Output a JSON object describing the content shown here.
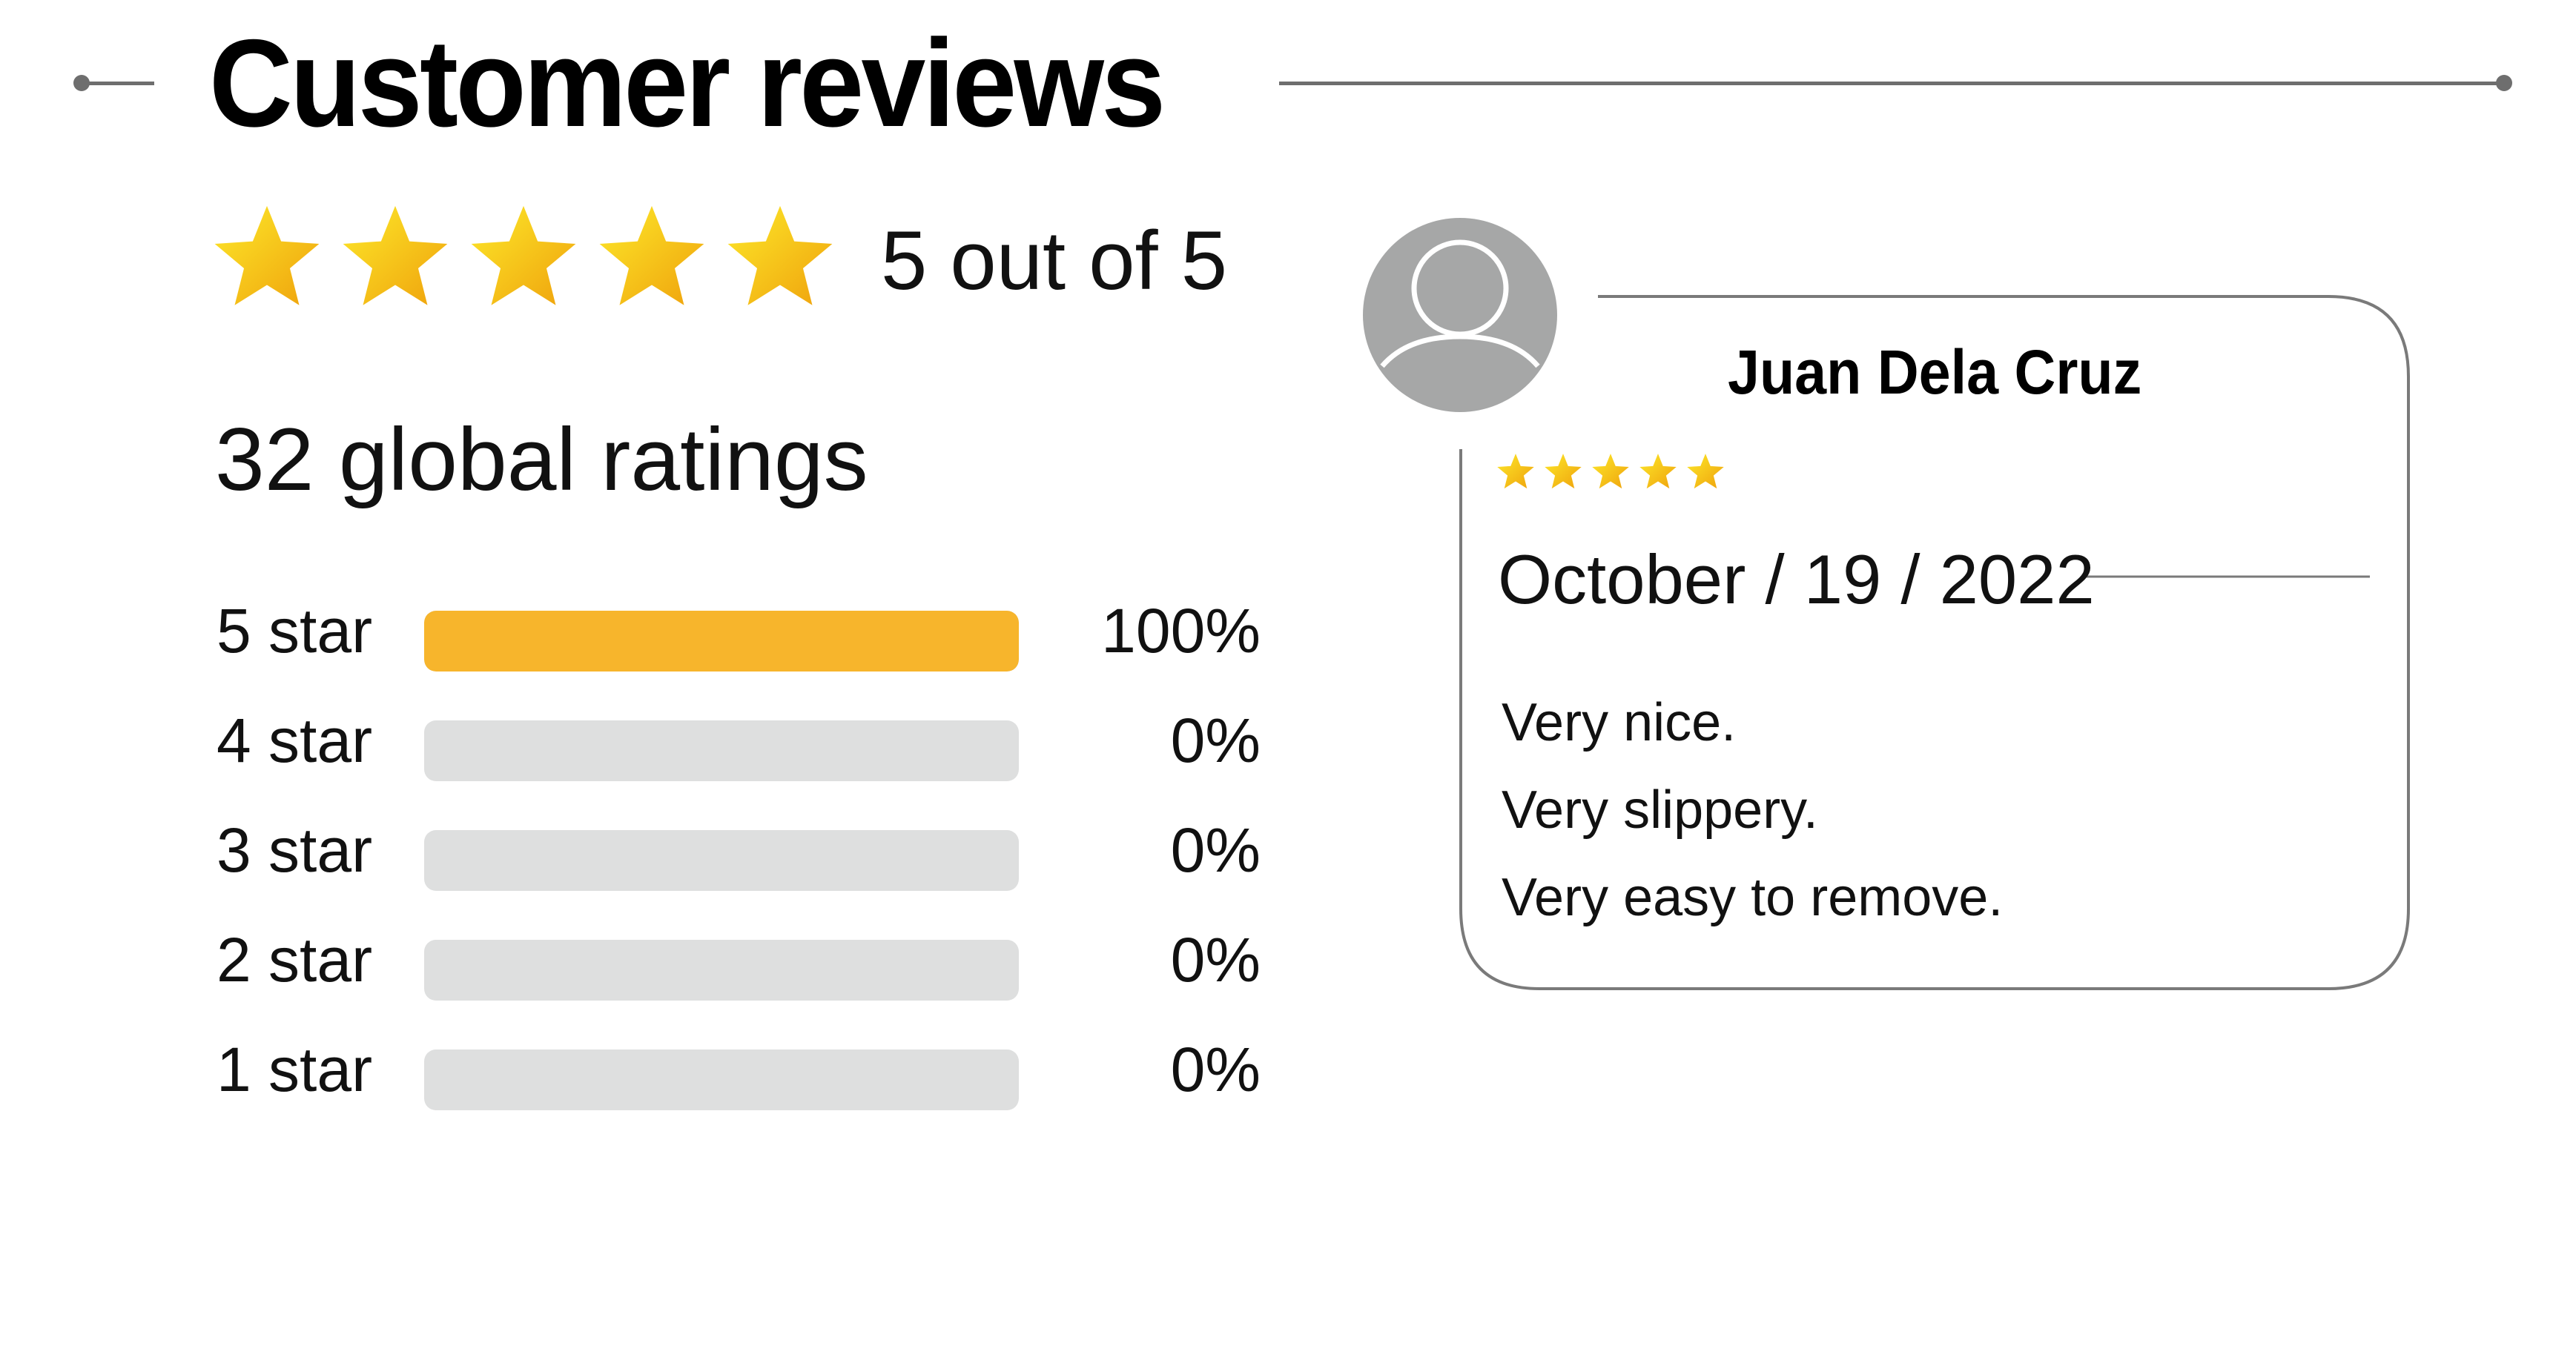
{
  "header": {
    "title": "Customer reviews"
  },
  "summary": {
    "star_count": 5,
    "rating_text": "5 out of 5",
    "global_ratings": "32 global ratings"
  },
  "histogram": [
    {
      "label": "5 star",
      "percent_text": "100%",
      "fraction": 1.0
    },
    {
      "label": "4 star",
      "percent_text": "0%",
      "fraction": 0.0
    },
    {
      "label": "3 star",
      "percent_text": "0%",
      "fraction": 0.0
    },
    {
      "label": "2 star",
      "percent_text": "0%",
      "fraction": 0.0
    },
    {
      "label": "1 star",
      "percent_text": "0%",
      "fraction": 0.0
    }
  ],
  "review": {
    "reviewer_name": "Juan Dela Cruz",
    "avatar_icon": "user-avatar-icon",
    "stars": 5,
    "date": "October  / 19 / 2022",
    "lines": [
      "Very nice.",
      "Very slippery.",
      "Very easy to remove."
    ]
  },
  "colors": {
    "accent": "#f7b52c",
    "track": "#dedfdf",
    "star_light": "#fde92a",
    "star_dark": "#efa10c",
    "line": "#6e6e6e",
    "avatar_bg": "#a6a7a7"
  }
}
